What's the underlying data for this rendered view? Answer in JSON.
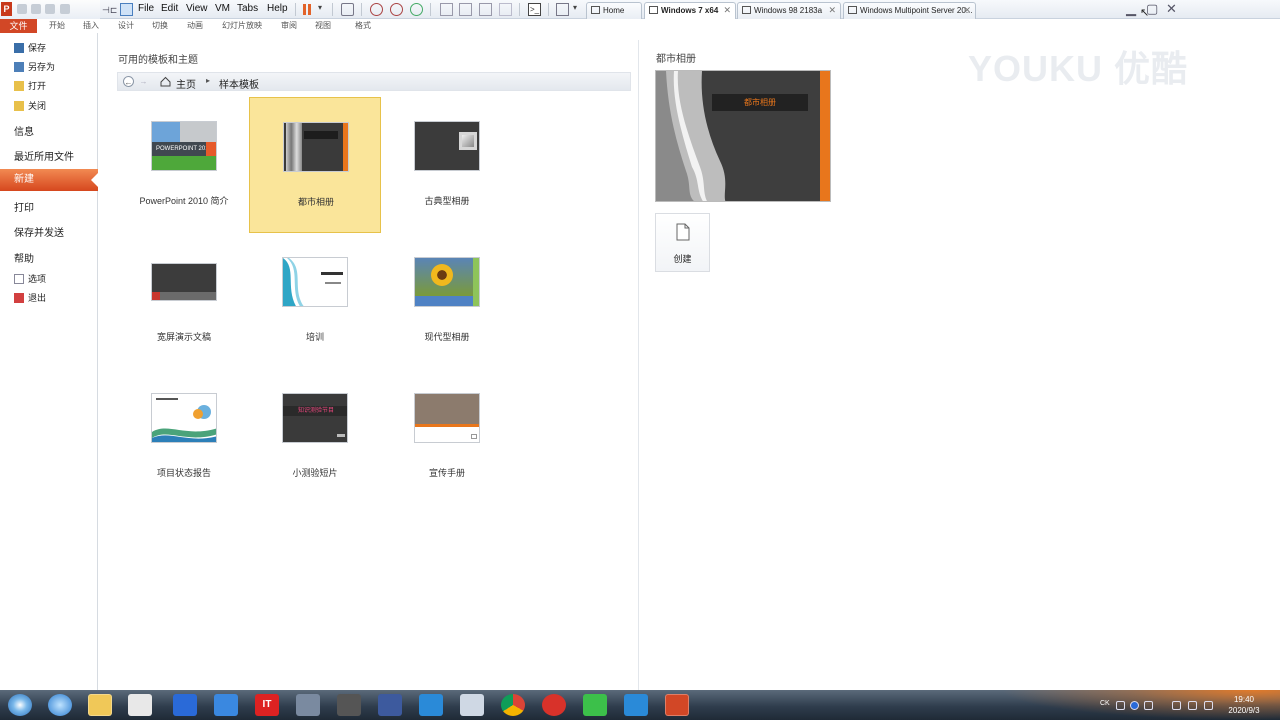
{
  "vmware": {
    "menus": [
      "File",
      "Edit",
      "View",
      "VM",
      "Tabs",
      "Help"
    ],
    "tabs": [
      {
        "label": "Home",
        "active": false
      },
      {
        "label": "Windows 7 x64",
        "active": true
      },
      {
        "label": "Windows 98 2183a",
        "active": false
      },
      {
        "label": "Windows Multipoint Server 20...",
        "active": false
      }
    ]
  },
  "ribbon": {
    "file_tab": "文件",
    "tabs": [
      "开始",
      "插入",
      "设计",
      "切换",
      "动画",
      "幻灯片放映",
      "审阅",
      "视图",
      "格式"
    ]
  },
  "nav": {
    "save": "保存",
    "save_as": "另存为",
    "open": "打开",
    "close": "关闭",
    "info": "信息",
    "recent": "最近所用文件",
    "new": "新建",
    "print": "打印",
    "save_send": "保存并发送",
    "help": "帮助",
    "options": "选项",
    "exit": "退出"
  },
  "templates": {
    "heading": "可用的模板和主题",
    "breadcrumb_home": "主页",
    "breadcrumb_current": "样本模板",
    "items": [
      {
        "label": "PowerPoint 2010 简介",
        "thumb_text": "POWERPOINT 2010"
      },
      {
        "label": "都市相册",
        "selected": true
      },
      {
        "label": "古典型相册"
      },
      {
        "label": "宽屏演示文稿"
      },
      {
        "label": "培训"
      },
      {
        "label": "现代型相册"
      },
      {
        "label": "项目状态报告"
      },
      {
        "label": "小测验短片",
        "thumb_text": "知识测验节目"
      },
      {
        "label": "宣传手册"
      }
    ]
  },
  "preview": {
    "title": "都市相册",
    "slide_title": "都市相册",
    "create_label": "创建"
  },
  "watermark": "YOUKU 优酷",
  "taskbar": {
    "time": "19:40",
    "date": "2020/9/3",
    "lang": "CK"
  },
  "colors": {
    "accent": "#d24726",
    "selected_tile": "#fae59a"
  }
}
